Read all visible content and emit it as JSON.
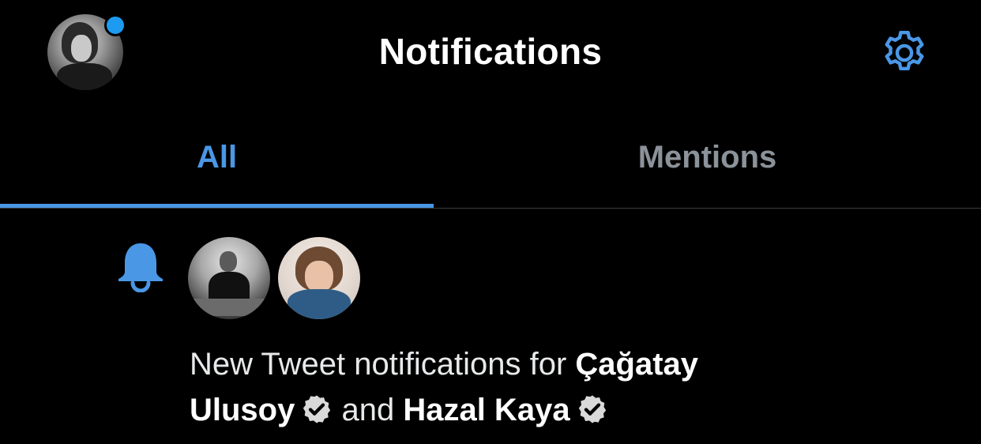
{
  "header": {
    "title": "Notifications",
    "avatar_icon": "profile-avatar",
    "settings_icon": "gear-icon"
  },
  "tabs": [
    {
      "label": "All",
      "active": true
    },
    {
      "label": "Mentions",
      "active": false
    }
  ],
  "notification": {
    "icon": "bell-icon",
    "text_prefix": "New Tweet notifications for ",
    "user_1": "Çağatay Ulusoy",
    "conjunction": " and ",
    "user_2": "Hazal Kaya",
    "badge_icon": "verified-icon"
  },
  "colors": {
    "accent": "#4a97e6",
    "background": "#000000",
    "inactive_tab": "#8b929a",
    "verified_badge": "#d9d9d9"
  }
}
